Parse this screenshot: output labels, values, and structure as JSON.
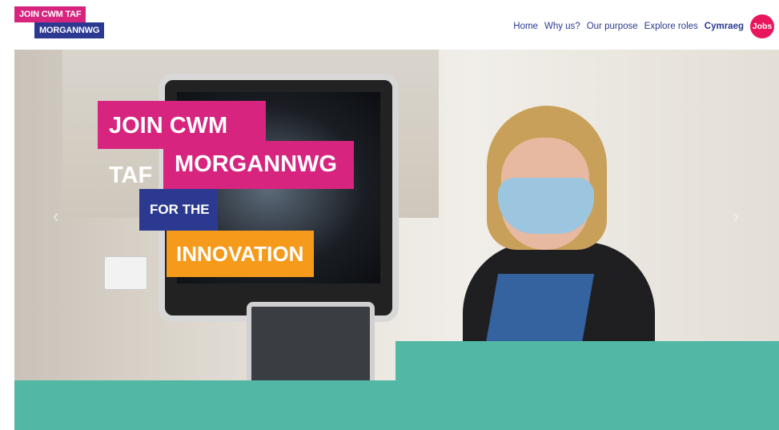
{
  "logo": {
    "line1": "JOIN CWM TAF",
    "line2": "MORGANNWG"
  },
  "nav": {
    "items": [
      "Home",
      "Why us?",
      "Our purpose",
      "Explore roles"
    ],
    "language": "Cymraeg",
    "jobs_button": "Jobs"
  },
  "hero": {
    "line1": "JOIN CWM TAF",
    "line2": "MORGANNWG",
    "line3": "FOR THE",
    "line4": "INNOVATION",
    "prev_icon": "‹",
    "next_icon": "›"
  },
  "colors": {
    "brand_pink": "#d6247f",
    "brand_navy": "#2b3990",
    "accent_orange": "#f59a1b",
    "teal": "#52b8a5",
    "jobs_red": "#e8175d"
  }
}
